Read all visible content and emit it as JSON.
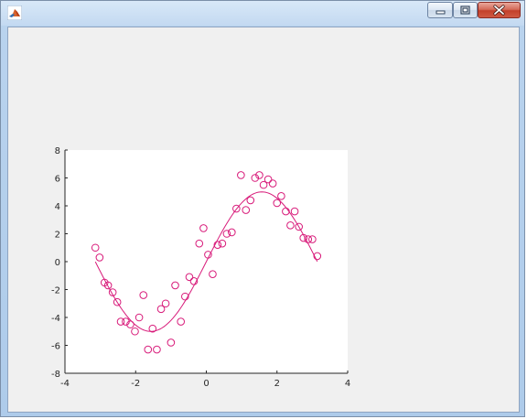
{
  "window": {
    "title": "",
    "icon": "matlab-icon",
    "controls": [
      "minimize-icon",
      "maximize-icon",
      "close-icon"
    ]
  },
  "colors": {
    "series": "#d81b7a",
    "axes_bg": "#ffffff",
    "figure_bg": "#f0f0f0"
  },
  "chart_data": {
    "type": "scatter",
    "title": "",
    "xlabel": "",
    "ylabel": "",
    "xlim": [
      -4,
      4
    ],
    "ylim": [
      -8,
      8
    ],
    "grid": false,
    "x_ticks": [
      "-4",
      "-2",
      "0",
      "2",
      "4"
    ],
    "y_ticks": [
      "8",
      "6",
      "4",
      "2",
      "0",
      "-2",
      "-4",
      "-6",
      "-8"
    ],
    "series": [
      {
        "kind": "scatter",
        "marker": "circle-open",
        "color": "#d81b7a",
        "points": [
          [
            -3.14,
            1.0
          ],
          [
            -3.02,
            0.3
          ],
          [
            -2.88,
            -1.5
          ],
          [
            -2.78,
            -1.7
          ],
          [
            -2.65,
            -2.2
          ],
          [
            -2.52,
            -2.9
          ],
          [
            -2.42,
            -4.3
          ],
          [
            -2.28,
            -4.3
          ],
          [
            -2.15,
            -4.5
          ],
          [
            -2.02,
            -5.0
          ],
          [
            -1.9,
            -4.0
          ],
          [
            -1.78,
            -2.4
          ],
          [
            -1.65,
            -6.3
          ],
          [
            -1.52,
            -4.8
          ],
          [
            -1.4,
            -6.3
          ],
          [
            -1.28,
            -3.4
          ],
          [
            -1.15,
            -3.0
          ],
          [
            -1.0,
            -5.8
          ],
          [
            -0.88,
            -1.7
          ],
          [
            -0.72,
            -4.3
          ],
          [
            -0.6,
            -2.5
          ],
          [
            -0.48,
            -1.1
          ],
          [
            -0.35,
            -1.4
          ],
          [
            -0.2,
            1.3
          ],
          [
            -0.08,
            2.4
          ],
          [
            0.05,
            0.5
          ],
          [
            0.18,
            -0.9
          ],
          [
            0.32,
            1.2
          ],
          [
            0.45,
            1.3
          ],
          [
            0.58,
            2.0
          ],
          [
            0.72,
            2.1
          ],
          [
            0.85,
            3.8
          ],
          [
            0.98,
            6.2
          ],
          [
            1.12,
            3.7
          ],
          [
            1.25,
            4.4
          ],
          [
            1.38,
            6.0
          ],
          [
            1.5,
            6.2
          ],
          [
            1.62,
            5.5
          ],
          [
            1.75,
            5.9
          ],
          [
            1.88,
            5.6
          ],
          [
            2.0,
            4.2
          ],
          [
            2.12,
            4.7
          ],
          [
            2.25,
            3.6
          ],
          [
            2.38,
            2.6
          ],
          [
            2.5,
            3.6
          ],
          [
            2.62,
            2.5
          ],
          [
            2.75,
            1.7
          ],
          [
            2.88,
            1.6
          ],
          [
            3.0,
            1.6
          ],
          [
            3.14,
            0.4
          ]
        ]
      },
      {
        "kind": "line",
        "color": "#d81b7a",
        "function": "5*sin(x)",
        "x_range": [
          -3.14,
          3.14
        ]
      }
    ]
  }
}
